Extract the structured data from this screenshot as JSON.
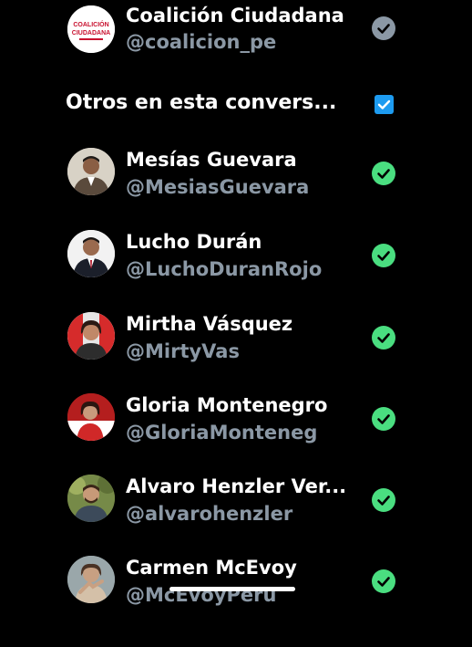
{
  "top_account": {
    "name": "Coalición Ciudadana",
    "handle": "@coalicion_pe",
    "avatar_text_line1": "COALICIÓN",
    "avatar_text_line2": "CIUDADANA",
    "status_icon": "check-circle-icon",
    "status_color": "#8b98a5"
  },
  "section": {
    "title": "Otros en esta convers...",
    "checkbox_checked": true,
    "checkbox_color": "#1d9bf0"
  },
  "people": [
    {
      "name": "Mesías Guevara",
      "handle": "@MesiasGuevara",
      "status_icon": "check-circle-icon",
      "status_color": "#4ade80"
    },
    {
      "name": "Lucho Durán",
      "handle": "@LuchoDuranRojo",
      "status_icon": "check-circle-icon",
      "status_color": "#4ade80"
    },
    {
      "name": "Mirtha Vásquez",
      "handle": "@MirtyVas",
      "status_icon": "check-circle-icon",
      "status_color": "#4ade80"
    },
    {
      "name": "Gloria Montenegro",
      "handle": "@GloriaMonteneg",
      "status_icon": "check-circle-icon",
      "status_color": "#4ade80"
    },
    {
      "name": "Alvaro Henzler Ver...",
      "handle": "@alvarohenzler",
      "status_icon": "check-circle-icon",
      "status_color": "#4ade80"
    },
    {
      "name": "Carmen McEvoy",
      "handle": "@McEvoyPeru",
      "status_icon": "check-circle-icon",
      "status_color": "#4ade80"
    }
  ]
}
